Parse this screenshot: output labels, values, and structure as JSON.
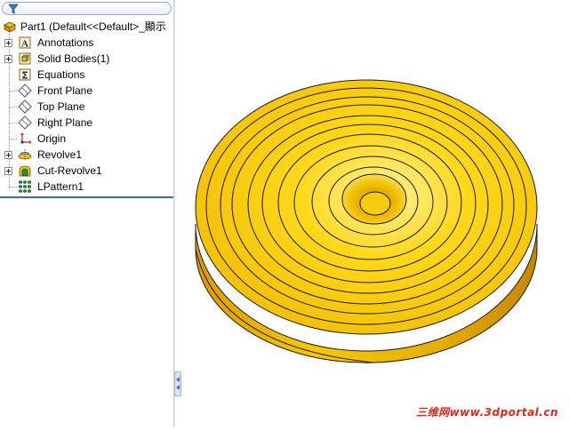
{
  "tree": {
    "filter_icon": "filter-icon",
    "root": {
      "label": "Part1  (Default<<Default>_顯示",
      "icon": "part-icon"
    },
    "items": [
      {
        "label": "Annotations",
        "icon": "annotations-icon",
        "expandable": true
      },
      {
        "label": "Solid Bodies(1)",
        "icon": "solid-bodies-icon",
        "expandable": true
      },
      {
        "label": "Equations",
        "icon": "equations-icon",
        "expandable": false
      },
      {
        "label": "Front Plane",
        "icon": "plane-icon",
        "expandable": false
      },
      {
        "label": "Top Plane",
        "icon": "plane-icon",
        "expandable": false
      },
      {
        "label": "Right Plane",
        "icon": "plane-icon",
        "expandable": false
      },
      {
        "label": "Origin",
        "icon": "origin-icon",
        "expandable": false
      },
      {
        "label": "Revolve1",
        "icon": "revolve-icon",
        "expandable": true
      },
      {
        "label": "Cut-Revolve1",
        "icon": "cut-revolve-icon",
        "expandable": true
      },
      {
        "label": "LPattern1",
        "icon": "linear-pattern-icon",
        "expandable": false
      }
    ]
  },
  "model": {
    "part_color": "#f5c400",
    "edge_color": "#1a1a1a",
    "ring_count": 9
  },
  "watermark": "三维网www.3dportal.cn"
}
